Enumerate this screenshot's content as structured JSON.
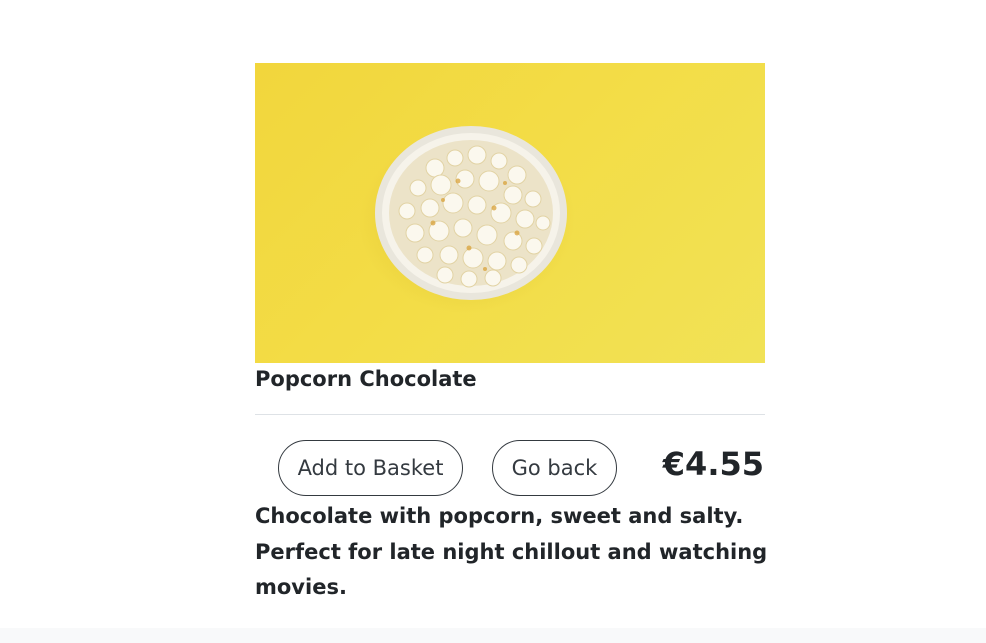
{
  "product": {
    "image_alt": "Bowl of popcorn on a yellow background",
    "title": "Popcorn Chocolate",
    "price": "€4.55",
    "description": "Chocolate with popcorn, sweet and salty. Perfect for late night chillout and watching movies."
  },
  "actions": {
    "add_to_basket_label": "Add to Basket",
    "go_back_label": "Go back"
  },
  "colors": {
    "image_background": "#f2d93f",
    "text": "#212529",
    "button_border": "#343a40",
    "divider": "#dee2e6",
    "footer_background": "#f8f9fa"
  }
}
